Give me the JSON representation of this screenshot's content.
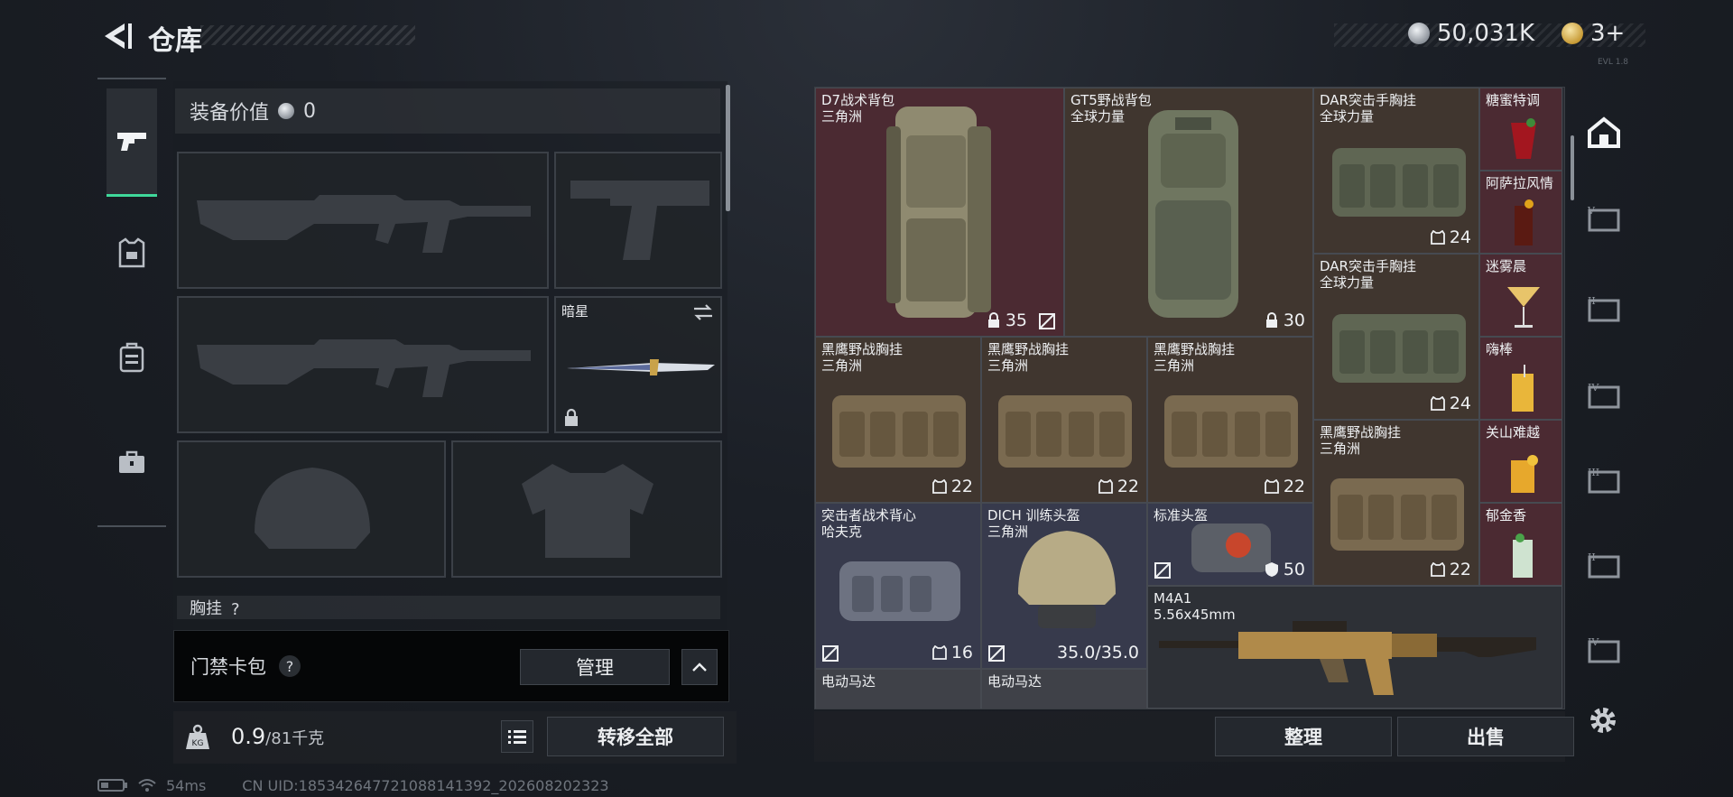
{
  "header": {
    "title": "仓库",
    "silver_amount": "50,031K",
    "gold_amount": "3+",
    "version_tag": "EVL 1.8"
  },
  "left_nav": {
    "items": [
      {
        "name": "weapon",
        "icon": "pistol-icon"
      },
      {
        "name": "armor",
        "icon": "armor-vest-icon"
      },
      {
        "name": "backpack",
        "icon": "backpack-icon"
      },
      {
        "name": "toolbox",
        "icon": "briefcase-icon"
      }
    ]
  },
  "equipment": {
    "value_label": "装备价值",
    "value": "0",
    "melee_name": "暗星",
    "chest_rig_label": "胸挂",
    "chest_rig_help": "?"
  },
  "card_pack": {
    "label": "门禁卡包",
    "help": "?",
    "manage_label": "管理"
  },
  "weight": {
    "icon_text": "KG",
    "current": "0.9",
    "capacity": "/81千克",
    "transfer_all_label": "转移全部"
  },
  "stash": {
    "items": [
      {
        "id": "d7",
        "name": "D7战术背包",
        "sub": "三角洲",
        "count": "35",
        "count_icon": "lock-icon",
        "blocked": true
      },
      {
        "id": "gt5",
        "name": "GT5野战背包",
        "sub": "全球力量",
        "count": "30",
        "count_icon": "lock-icon"
      },
      {
        "id": "dar1",
        "name": "DAR突击手胸挂",
        "sub": "全球力量",
        "count": "24",
        "count_icon": "vest-icon"
      },
      {
        "id": "dar2",
        "name": "DAR突击手胸挂",
        "sub": "全球力量",
        "count": "24",
        "count_icon": "vest-icon"
      },
      {
        "id": "hy1",
        "name": "黑鹰野战胸挂",
        "sub": "三角洲",
        "count": "22",
        "count_icon": "vest-icon"
      },
      {
        "id": "hy2",
        "name": "黑鹰野战胸挂",
        "sub": "三角洲",
        "count": "22",
        "count_icon": "vest-icon"
      },
      {
        "id": "hy3",
        "name": "黑鹰野战胸挂",
        "sub": "三角洲",
        "count": "22",
        "count_icon": "vest-icon"
      },
      {
        "id": "hy4",
        "name": "黑鹰野战胸挂",
        "sub": "三角洲",
        "count": "22",
        "count_icon": "vest-icon"
      },
      {
        "id": "tjz",
        "name": "突击者战术背心",
        "sub": "哈夫克",
        "count": "16",
        "count_icon": "vest-icon",
        "blocked": true
      },
      {
        "id": "dich",
        "name": "DICH 训练头盔",
        "sub": "三角洲",
        "count": "35.0/35.0",
        "blocked": true
      },
      {
        "id": "bzt",
        "name": "标准头盔",
        "sub": "",
        "count": "50",
        "count_icon": "shield-icon",
        "blocked": true
      },
      {
        "id": "m4a1",
        "name": "M4A1",
        "sub": "5.56x45mm"
      },
      {
        "id": "dm1",
        "name": "电动马达",
        "sub": ""
      },
      {
        "id": "dm2",
        "name": "电动马达",
        "sub": ""
      }
    ],
    "drinks": [
      "糖蜜特调",
      "阿萨拉风情",
      "迷雾晨",
      "嗨棒",
      "关山难越",
      "郁金香"
    ]
  },
  "right_nav": {
    "items": [
      "home-icon",
      "tier-v-icon",
      "tier-ii-icon",
      "tier-iv-icon",
      "tier-iii-icon",
      "tier-ii-icon",
      "tier-iv-icon"
    ]
  },
  "bottom": {
    "sort_label": "整理",
    "sell_label": "出售"
  },
  "status": {
    "ping": "54ms",
    "uid": "CN UID:18534264772108814139​2_202608202323"
  },
  "colors": {
    "accent_green": "#3fd89a",
    "red_rarity": "#4b2a32",
    "brown_rarity": "#40362f",
    "blue_rarity": "#373a4c"
  }
}
